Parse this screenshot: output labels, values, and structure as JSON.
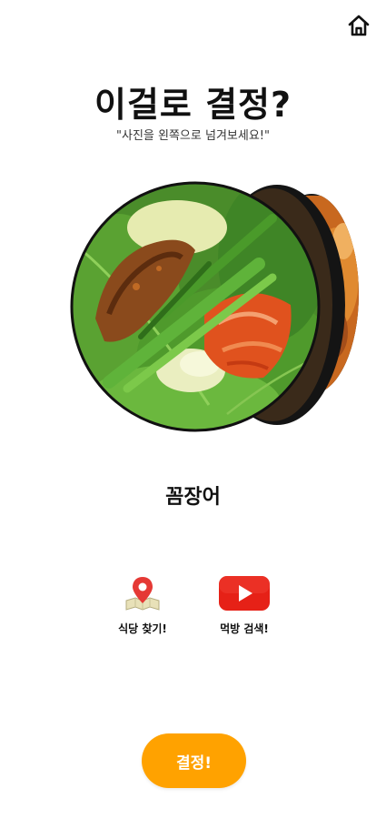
{
  "header": {
    "home_icon": "home-icon"
  },
  "main": {
    "title": "이걸로 결정?",
    "subtitle": "\"사진을 왼쪽으로 넘겨보세요!\"",
    "food_name": "꼼장어"
  },
  "actions": [
    {
      "label": "식당 찾기!",
      "icon": "map-pin-icon",
      "color": "#E53935"
    },
    {
      "label": "먹방 검색!",
      "icon": "youtube-icon",
      "color": "#E62117"
    }
  ],
  "decide_button": {
    "label": "결정!",
    "color": "#FFA200"
  }
}
